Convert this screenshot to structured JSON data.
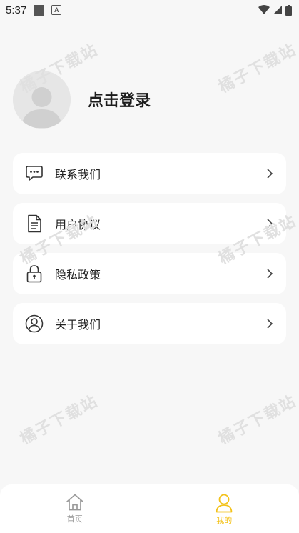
{
  "status_bar": {
    "time": "5:37",
    "notif_letter": "A"
  },
  "profile": {
    "login_label": "点击登录"
  },
  "menu": [
    {
      "label": "联系我们",
      "icon": "chat-icon"
    },
    {
      "label": "用户协议",
      "icon": "document-icon"
    },
    {
      "label": "隐私政策",
      "icon": "lock-icon"
    },
    {
      "label": "关于我们",
      "icon": "user-circle-icon"
    }
  ],
  "watermark": "橘子下载站",
  "bottom_nav": {
    "home_label": "首页",
    "mine_label": "我的"
  },
  "colors": {
    "accent": "#f3c21a",
    "background": "#f7f7f7",
    "card": "#ffffff",
    "inactive": "#999999"
  }
}
